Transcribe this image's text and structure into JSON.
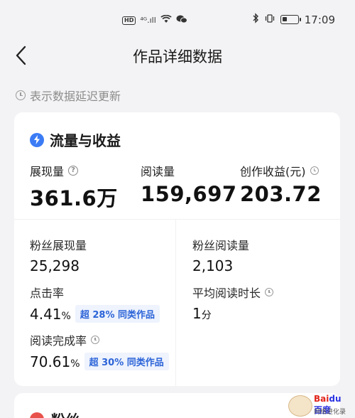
{
  "status_bar": {
    "hd_label": "HD",
    "signal_label": "⁴ᴳ.ıll",
    "time": "17:09"
  },
  "nav": {
    "title": "作品详细数据"
  },
  "notice": {
    "text": "表示数据延迟更新"
  },
  "card": {
    "title": "流量与收益",
    "accent_color": "#3b7cf5",
    "top_metrics": [
      {
        "label": "展现量",
        "value": "361.6万"
      },
      {
        "label": "阅读量",
        "value": "159,697"
      },
      {
        "label": "创作收益(元)",
        "value": "203.72"
      }
    ],
    "sub_metrics": {
      "fan_impressions": {
        "label": "粉丝展现量",
        "value": "25,298"
      },
      "fan_reads": {
        "label": "粉丝阅读量",
        "value": "2,103"
      },
      "ctr": {
        "label": "点击率",
        "value": "4.41",
        "unit": "%",
        "badge_prefix": "超 ",
        "badge_pct": "28%",
        "badge_suffix": " 同类作品"
      },
      "avg_read_time": {
        "label": "平均阅读时长",
        "value": "1",
        "unit": "分"
      },
      "completion_rate": {
        "label": "阅读完成率",
        "value": "70.61",
        "unit": "%",
        "badge_prefix": "超 ",
        "badge_pct": "30%",
        "badge_suffix": " 同类作品"
      }
    }
  },
  "card2": {
    "title": "粉丝"
  },
  "watermark": {
    "brand_bai": "Bai",
    "brand_du": "du百度",
    "sub": "网络进化录"
  }
}
